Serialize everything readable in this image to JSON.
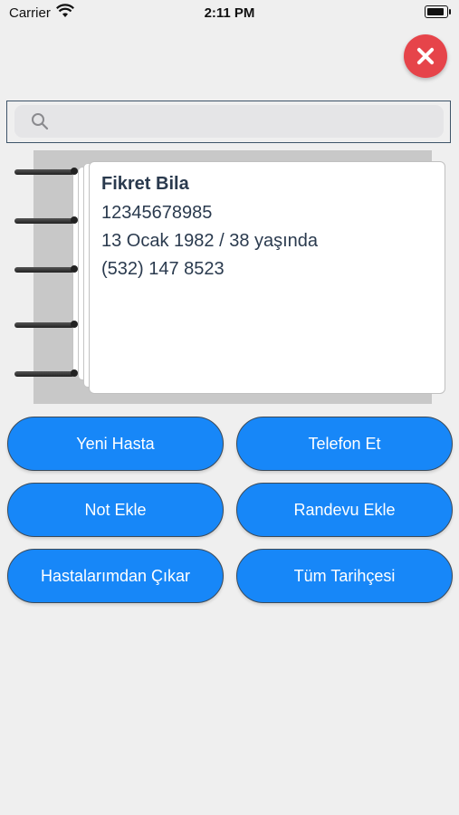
{
  "status_bar": {
    "carrier": "Carrier",
    "time": "2:11 PM"
  },
  "search": {
    "placeholder": ""
  },
  "patient": {
    "name": "Fikret Bila",
    "id_number": "12345678985",
    "birth_age": "13 Ocak 1982  /  38 yaşında",
    "phone": "(532) 147 8523"
  },
  "buttons": {
    "new_patient": "Yeni Hasta",
    "call": "Telefon Et",
    "add_note": "Not Ekle",
    "add_appointment": "Randevu Ekle",
    "remove_from_patients": "Hastalarımdan Çıkar",
    "full_history": "Tüm Tarihçesi"
  },
  "colors": {
    "accent": "#1787f8",
    "close": "#e6444a"
  }
}
